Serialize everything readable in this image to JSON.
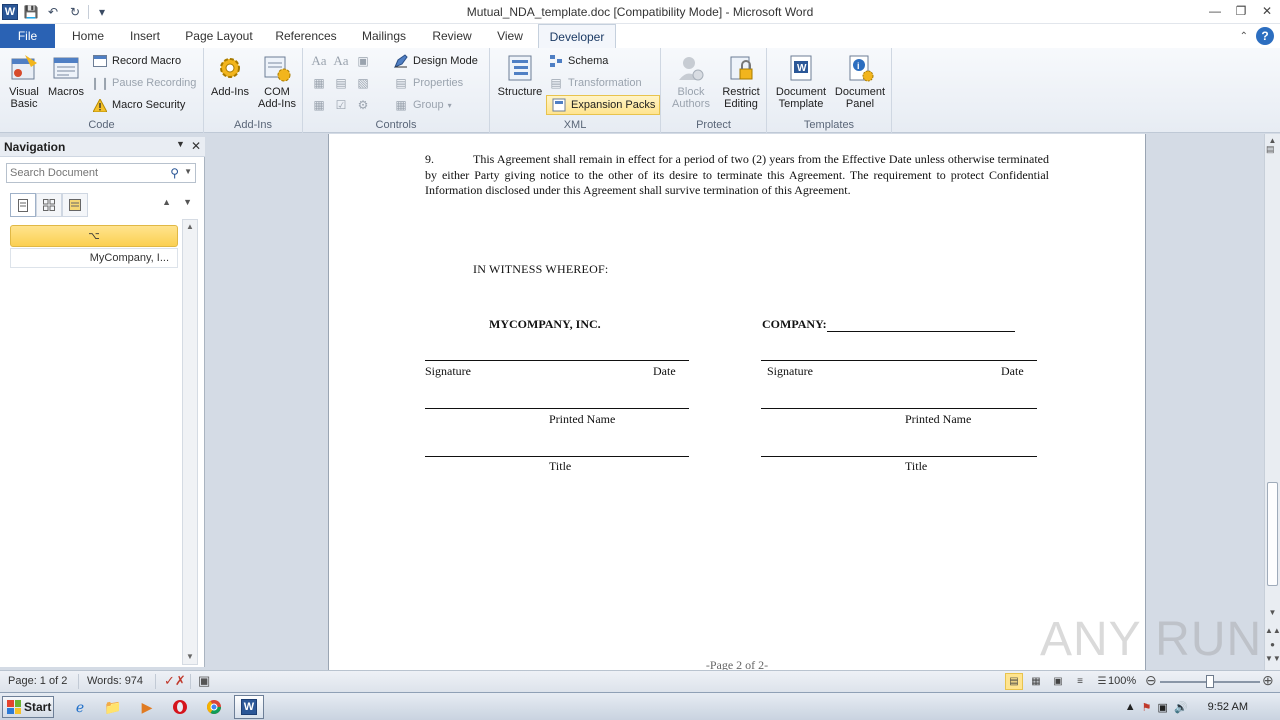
{
  "window": {
    "title": "Mutual_NDA_template.doc [Compatibility Mode] - Microsoft Word",
    "minimize": "—",
    "restore": "❐",
    "close": "✕"
  },
  "tabs": [
    "File",
    "Home",
    "Insert",
    "Page Layout",
    "References",
    "Mailings",
    "Review",
    "View",
    "Developer"
  ],
  "active_tab": "Developer",
  "ribbon": {
    "code": {
      "label": "Code",
      "visual_basic": "Visual\nBasic",
      "macros": "Macros",
      "record_macro": "Record Macro",
      "pause_recording": "Pause Recording",
      "macro_security": "Macro Security"
    },
    "addins": {
      "label": "Add-Ins",
      "add_ins": "Add-Ins",
      "com_add_ins": "COM\nAdd-Ins"
    },
    "controls": {
      "label": "Controls",
      "design_mode": "Design Mode",
      "properties": "Properties",
      "group": "Group"
    },
    "xml": {
      "label": "XML",
      "structure": "Structure",
      "schema": "Schema",
      "transformation": "Transformation",
      "expansion_packs": "Expansion Packs"
    },
    "protect": {
      "label": "Protect",
      "block_authors": "Block\nAuthors",
      "restrict_editing": "Restrict\nEditing"
    },
    "templates": {
      "label": "Templates",
      "document_template": "Document\nTemplate",
      "document_panel": "Document\nPanel"
    }
  },
  "navigation": {
    "title": "Navigation",
    "search_placeholder": "Search Document",
    "heading_item": "⌥",
    "sub_item": "MyCompany, I..."
  },
  "document": {
    "para9_num": "9.",
    "para9_text": "This Agreement shall remain in effect for a period of two (2) years from the Effective Date unless otherwise terminated by either Party giving notice to the other of its desire to terminate this Agreement.  The requirement to protect Confidential Information disclosed under this Agreement shall survive termination of this Agreement.",
    "witness": "IN WITNESS  WHEREOF:",
    "party_left": "MYCOMPANY,  INC.",
    "party_right": "COMPANY:",
    "signature": "Signature",
    "date": "Date",
    "printed_name": "Printed Name",
    "title": "Title",
    "footer": "-Page 2 of 2-"
  },
  "watermark": "ANY RUN",
  "status": {
    "page": "Page: 1 of 2",
    "words": "Words: 974",
    "zoom": "100%"
  },
  "taskbar": {
    "start": "Start",
    "clock": "9:52 AM"
  }
}
